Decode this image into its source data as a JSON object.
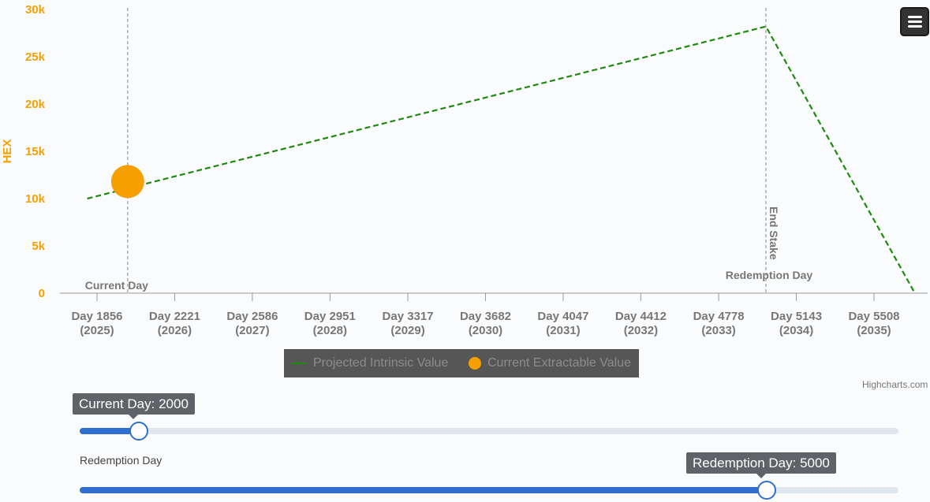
{
  "chart_data": {
    "type": "line",
    "ylabel": "HEX",
    "yticks": [
      "0",
      "5k",
      "10k",
      "15k",
      "20k",
      "25k",
      "30k"
    ],
    "ylim": [
      0,
      30000
    ],
    "xlim": [
      1770,
      5650
    ],
    "xticks": [
      {
        "day": 1856,
        "label": "Day 1856",
        "year": "(2025)"
      },
      {
        "day": 2221,
        "label": "Day 2221",
        "year": "(2026)"
      },
      {
        "day": 2586,
        "label": "Day 2586",
        "year": "(2027)"
      },
      {
        "day": 2951,
        "label": "Day 2951",
        "year": "(2028)"
      },
      {
        "day": 3317,
        "label": "Day 3317",
        "year": "(2029)"
      },
      {
        "day": 3682,
        "label": "Day 3682",
        "year": "(2030)"
      },
      {
        "day": 4047,
        "label": "Day 4047",
        "year": "(2031)"
      },
      {
        "day": 4412,
        "label": "Day 4412",
        "year": "(2032)"
      },
      {
        "day": 4778,
        "label": "Day 4778",
        "year": "(2033)"
      },
      {
        "day": 5143,
        "label": "Day 5143",
        "year": "(2034)"
      },
      {
        "day": 5508,
        "label": "Day 5508",
        "year": "(2035)"
      }
    ],
    "series": [
      {
        "name": "Projected Intrinsic Value",
        "color": "#1e8a0e",
        "dash": true,
        "points": [
          [
            1810,
            10000
          ],
          [
            5000,
            28200
          ],
          [
            5700,
            0
          ]
        ]
      },
      {
        "name": "Current Extractable Value",
        "color": "#f5a000",
        "points": [
          [
            2000,
            11800
          ]
        ]
      }
    ],
    "plot_lines": [
      {
        "day": 2000,
        "label": "Current Day",
        "orientation": "horizontal"
      },
      {
        "day": 5000,
        "label": "Redemption Day",
        "side_label": "End Stake"
      }
    ],
    "grid": false,
    "legend_position": "bottom-center"
  },
  "toolbar": {
    "menu_icon": "hamburger-menu-icon"
  },
  "credits": "Highcharts.com",
  "sliders": {
    "current": {
      "tooltip": "Current Day: 2000",
      "value": 2000,
      "min": 1810,
      "max": 5700
    },
    "redemption": {
      "label": "Redemption Day",
      "tooltip": "Redemption Day: 5000",
      "value": 5000,
      "min": 1810,
      "max": 5700
    }
  },
  "colors": {
    "accent": "#2f6fd0",
    "axis": "#f5a000",
    "line": "#1e8a0e"
  }
}
